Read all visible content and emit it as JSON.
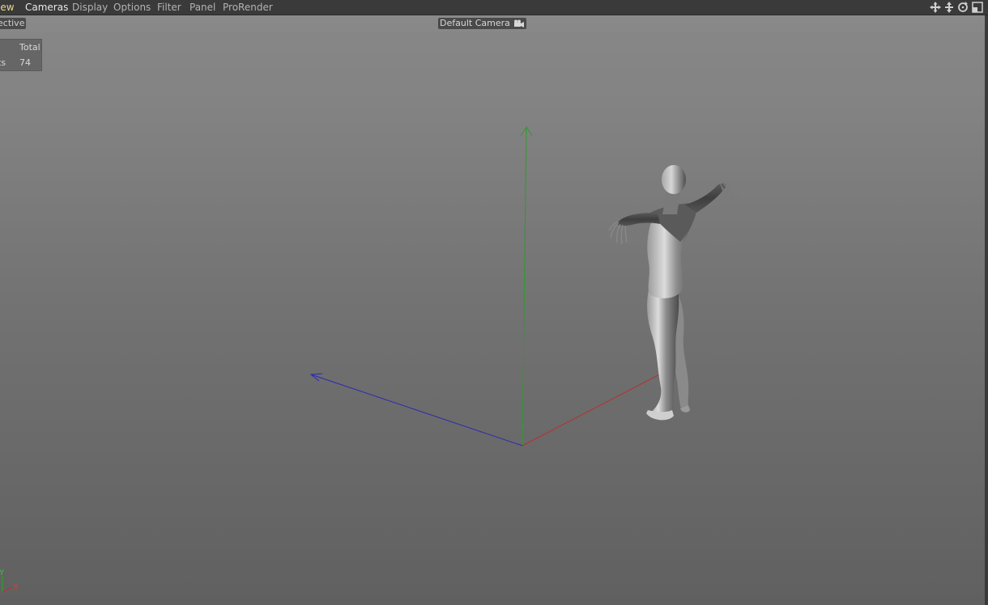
{
  "menubar": {
    "items": [
      {
        "label": "iew"
      },
      {
        "label": "Cameras"
      },
      {
        "label": "Display"
      },
      {
        "label": "Options"
      },
      {
        "label": "Filter"
      },
      {
        "label": "Panel"
      },
      {
        "label": "ProRender"
      }
    ],
    "nav_icons": [
      "move-icon",
      "dolly-icon",
      "rotate-icon",
      "maximize-icon"
    ]
  },
  "viewport": {
    "projection": "ective",
    "camera": "Default Camera",
    "stats": {
      "header": "Total",
      "label": "cts",
      "value": "74"
    },
    "axis_gizmo": {
      "y_label": "Y",
      "x_label": "X"
    },
    "colors": {
      "x_axis": "#c03030",
      "y_axis": "#30a030",
      "z_axis": "#3030c0",
      "active_menu": "#e8d98a"
    }
  }
}
